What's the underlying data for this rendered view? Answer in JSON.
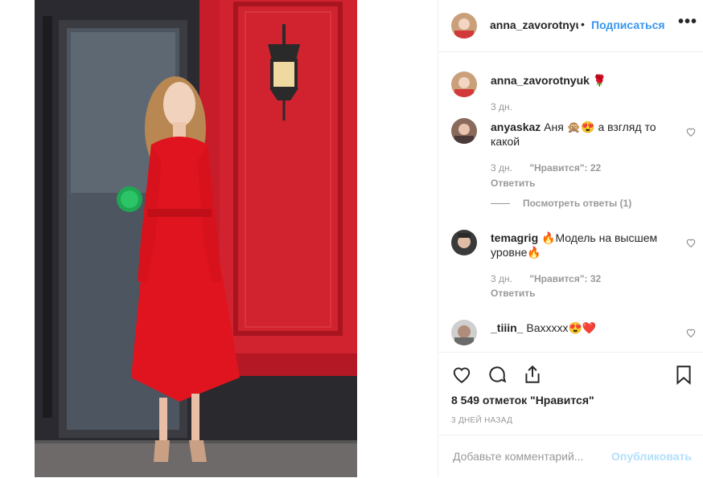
{
  "post": {
    "author": "anna_zavorotnyuk",
    "follow_label": "Подписаться",
    "separator": "•",
    "more_label": "•••"
  },
  "comments": [
    {
      "user": "anna_zavorotnyuk",
      "text": "🌹",
      "time": "3 дн."
    },
    {
      "user": "anyaskaz",
      "text": "Аня 🙊😍 а взгляд то какой",
      "time": "3 дн.",
      "likes": "\"Нравится\": 22",
      "reply": "Ответить",
      "view_replies": "Посмотреть ответы (1)"
    },
    {
      "user": "temagrig",
      "text": "🔥Модель на высшем уровне🔥",
      "time": "3 дн.",
      "likes": "\"Нравится\": 32",
      "reply": "Ответить"
    },
    {
      "user": "_tiiin_",
      "text": "Вахxxxx😍❤️"
    }
  ],
  "actions": {
    "likes_count": "8 549 отметок \"Нравится\"",
    "posted_ago": "3 ДНЕЙ НАЗАД"
  },
  "composer": {
    "placeholder": "Добавьте комментарий...",
    "publish_label": "Опубликовать"
  },
  "icons": [
    "heart-icon",
    "comment-icon",
    "share-icon",
    "bookmark-icon",
    "more-icon"
  ],
  "colors": {
    "link": "#3897f0",
    "publish_disabled": "#b2dffc",
    "meta": "#999999"
  }
}
